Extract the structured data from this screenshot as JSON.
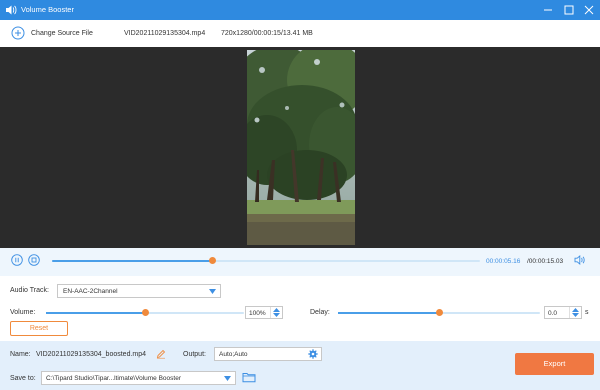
{
  "window": {
    "title": "Volume Booster",
    "accent": "#2f8ae0",
    "icon": "speaker-icon"
  },
  "infobar": {
    "change_source_label": "Change Source File",
    "file_name": "VID20211029135304.mp4",
    "file_meta": "720x1280/00:00:15/13.41 MB"
  },
  "player": {
    "current_time": "00:00:05.16",
    "total_time": "/00:00:15.03",
    "progress": 0.374
  },
  "settings": {
    "audio_track_label": "Audio Track:",
    "audio_track_value": "EN-AAC-2Channel",
    "volume_label": "Volume:",
    "volume_value": "100%",
    "volume_level": 0.5,
    "delay_label": "Delay:",
    "delay_value": "0.0",
    "delay_unit": "s",
    "delay_level": 0.5,
    "reset_label": "Reset"
  },
  "output_bar": {
    "name_label": "Name:",
    "name_value": "VID20211029135304_boosted.mp4",
    "output_label": "Output:",
    "output_value": "Auto;Auto",
    "save_to_label": "Save to:",
    "save_to_value": "C:\\Tipard Studio\\Tipar...ltimate\\Volume Booster",
    "export_label": "Export",
    "export_color": "#f07842"
  }
}
